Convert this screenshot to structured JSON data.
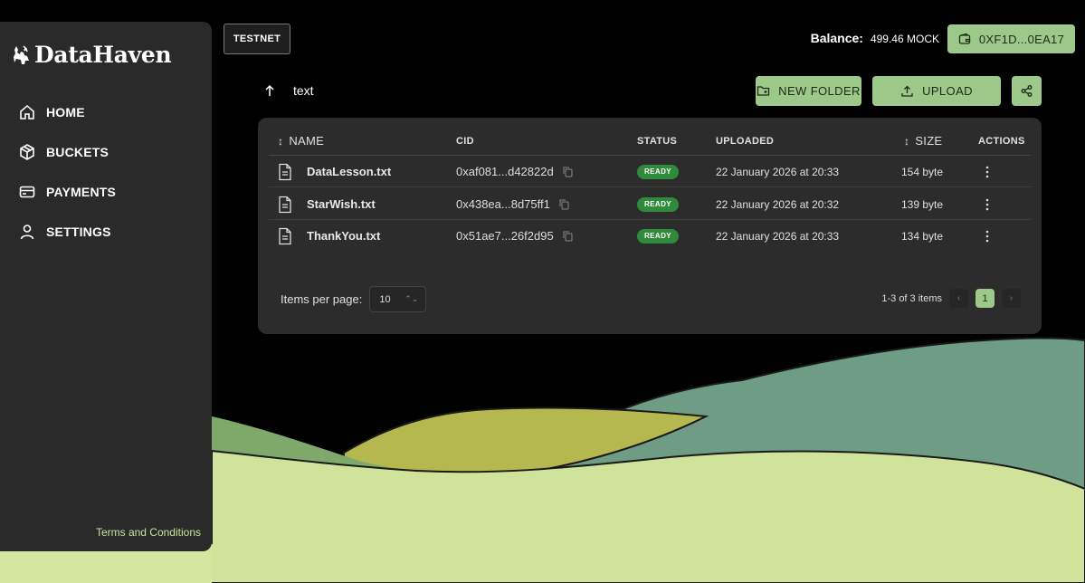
{
  "brand": {
    "name": "DataHaven"
  },
  "sidebar": {
    "items": [
      {
        "label": "HOME",
        "icon": "home-icon"
      },
      {
        "label": "BUCKETS",
        "icon": "box-icon"
      },
      {
        "label": "PAYMENTS",
        "icon": "card-icon"
      },
      {
        "label": "SETTINGS",
        "icon": "user-icon"
      }
    ],
    "terms": "Terms and Conditions"
  },
  "header": {
    "network": "TESTNET",
    "balance_label": "Balance:",
    "balance_value": "499.46 MOCK",
    "wallet_address": "0XF1D...0EA17"
  },
  "path": {
    "current": "text"
  },
  "actions": {
    "new_folder": "NEW FOLDER",
    "upload": "UPLOAD"
  },
  "table": {
    "columns": {
      "name": "NAME",
      "cid": "CID",
      "status": "STATUS",
      "uploaded": "UPLOADED",
      "size": "SIZE",
      "actions": "ACTIONS"
    },
    "rows": [
      {
        "name": "DataLesson.txt",
        "cid": "0xaf081...d42822d",
        "status": "READY",
        "uploaded": "22 January 2026 at 20:33",
        "size": "154 byte"
      },
      {
        "name": "StarWish.txt",
        "cid": "0x438ea...8d75ff1",
        "status": "READY",
        "uploaded": "22 January 2026 at 20:32",
        "size": "139 byte"
      },
      {
        "name": "ThankYou.txt",
        "cid": "0x51ae7...26f2d95",
        "status": "READY",
        "uploaded": "22 January 2026 at 20:33",
        "size": "134 byte"
      }
    ]
  },
  "pagination": {
    "items_per_page_label": "Items per page:",
    "items_per_page_value": "10",
    "range_text": "1-3 of 3 items",
    "current_page": "1",
    "prev": "‹",
    "next": "›"
  },
  "colors": {
    "accent": "#9cc98a",
    "status_ready": "#2f8a3c",
    "panel": "#2c2c2c",
    "sidebar": "#2a2a2a"
  }
}
